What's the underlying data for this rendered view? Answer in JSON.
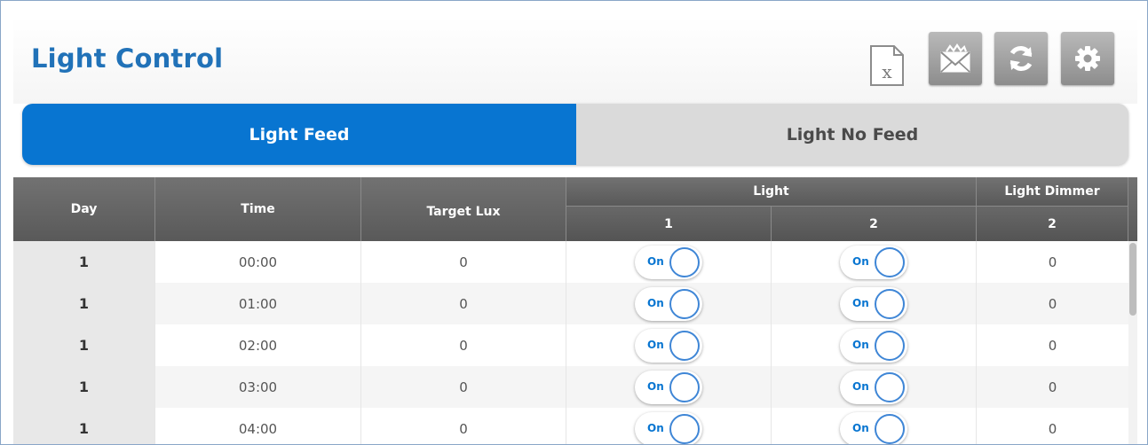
{
  "header": {
    "title": "Light Control"
  },
  "toolbar": {
    "buttons": [
      {
        "icon": "excel-export-icon"
      },
      {
        "icon": "envelope-icon"
      },
      {
        "icon": "refresh-icon"
      },
      {
        "icon": "gear-icon"
      }
    ]
  },
  "tabs": [
    {
      "label": "Light Feed",
      "active": true
    },
    {
      "label": "Light No Feed",
      "active": false
    }
  ],
  "table": {
    "headers": {
      "day": "Day",
      "time": "Time",
      "target_lux": "Target Lux",
      "light_group": "Light",
      "light_1": "1",
      "light_2": "2",
      "dimmer_group": "Light Dimmer",
      "dimmer_2": "2"
    },
    "rows": [
      {
        "day": "1",
        "time": "00:00",
        "target_lux": "0",
        "light1": "On",
        "light2": "On",
        "dimmer2": "0"
      },
      {
        "day": "1",
        "time": "01:00",
        "target_lux": "0",
        "light1": "On",
        "light2": "On",
        "dimmer2": "0"
      },
      {
        "day": "1",
        "time": "02:00",
        "target_lux": "0",
        "light1": "On",
        "light2": "On",
        "dimmer2": "0"
      },
      {
        "day": "1",
        "time": "03:00",
        "target_lux": "0",
        "light1": "On",
        "light2": "On",
        "dimmer2": "0"
      },
      {
        "day": "1",
        "time": "04:00",
        "target_lux": "0",
        "light1": "On",
        "light2": "On",
        "dimmer2": "0"
      }
    ]
  },
  "colors": {
    "accent": "#0875d1",
    "title": "#2172b8",
    "header_bg": "#636363"
  }
}
